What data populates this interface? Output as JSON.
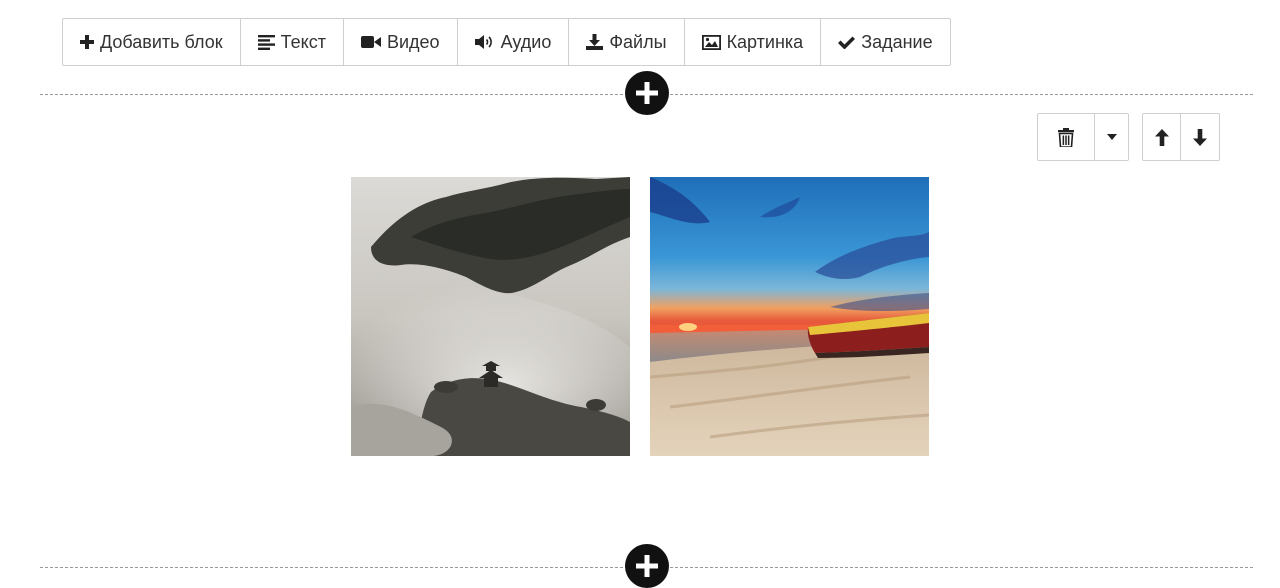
{
  "toolbar": {
    "add_block": "Добавить блок",
    "text": "Текст",
    "video": "Видео",
    "audio": "Аудио",
    "files": "Файлы",
    "image": "Картинка",
    "task": "Задание"
  },
  "block_controls": {
    "icons": [
      "trash-icon",
      "caret-down-icon",
      "arrow-up-icon",
      "arrow-down-icon"
    ]
  },
  "gallery": {
    "images": [
      {
        "name": "misty-mountain-photo"
      },
      {
        "name": "beach-sunset-boat-photo"
      }
    ]
  },
  "colors": {
    "text": "#333333",
    "border": "#cfcfcf",
    "add_circle": "#111111",
    "dashed_line": "#9a9a9a"
  }
}
